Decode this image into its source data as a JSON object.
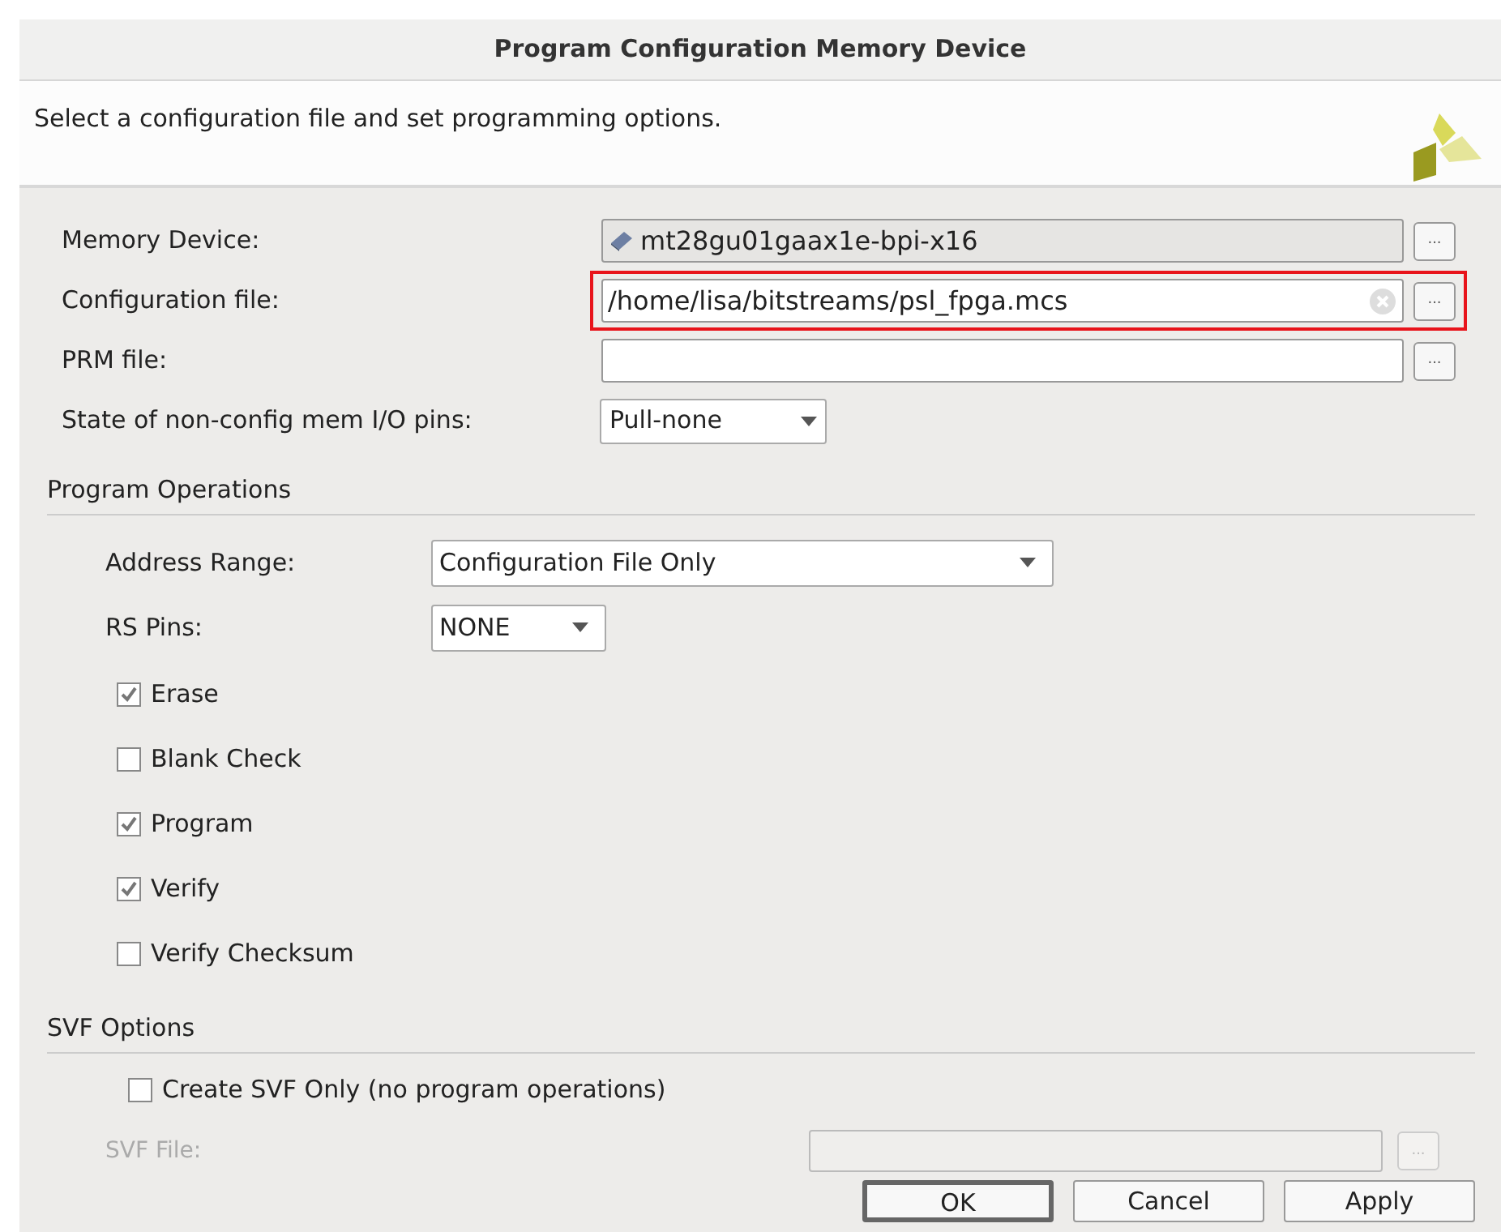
{
  "window": {
    "title": "Program Configuration Memory Device"
  },
  "description": "Select a configuration file and set programming options.",
  "fields": [
    {
      "kind": "readonly",
      "label": "Memory Device:",
      "value": "mt28gu01gaax1e-bpi-x16",
      "browse": "...",
      "highlighted": false
    },
    {
      "kind": "text",
      "label": "Configuration file:",
      "value": "/home/lisa/bitstreams/psl_fpga.mcs",
      "browse": "...",
      "highlighted": true
    },
    {
      "kind": "text",
      "label": "PRM file:",
      "browse": "...",
      "highlighted": false
    },
    {
      "kind": "dropdown",
      "label": "State of non-config mem I/O pins:",
      "value": "Pull-none",
      "highlighted": false
    }
  ],
  "program_operations": {
    "title": "Program Operations",
    "address_range": {
      "label": "Address Range:",
      "value": "Configuration File Only"
    },
    "rs_pins": {
      "label": "RS Pins:",
      "value": "NONE"
    },
    "options": [
      {
        "label": "Erase",
        "checked": true
      },
      {
        "label": "Blank Check",
        "checked": false
      },
      {
        "label": "Program",
        "checked": true
      },
      {
        "label": "Verify",
        "checked": true
      },
      {
        "label": "Verify Checksum",
        "checked": false
      }
    ]
  },
  "svf_options": {
    "title": "SVF Options",
    "create_svf_only": {
      "label": "Create SVF Only (no program operations)",
      "checked": false
    },
    "svf_file": {
      "label": "SVF File:",
      "browse": "...",
      "disabled": true
    }
  },
  "buttons": [
    {
      "label": "OK",
      "default": true
    },
    {
      "label": "Cancel",
      "default": false
    },
    {
      "label": "Apply",
      "default": false
    }
  ]
}
